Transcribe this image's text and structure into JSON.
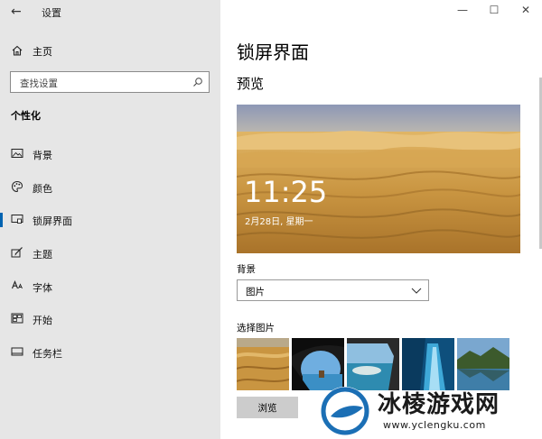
{
  "window": {
    "title": "设置",
    "minimize": "—",
    "maximize": "☐",
    "close": "✕"
  },
  "sidebar": {
    "home_label": "主页",
    "search_placeholder": "查找设置",
    "section_title": "个性化",
    "items": [
      {
        "label": "背景",
        "icon": "picture-icon"
      },
      {
        "label": "颜色",
        "icon": "palette-icon"
      },
      {
        "label": "锁屏界面",
        "icon": "lock-screen-icon",
        "active": true
      },
      {
        "label": "主题",
        "icon": "brush-icon"
      },
      {
        "label": "字体",
        "icon": "font-icon"
      },
      {
        "label": "开始",
        "icon": "start-icon"
      },
      {
        "label": "任务栏",
        "icon": "taskbar-icon"
      }
    ]
  },
  "main": {
    "title": "锁屏界面",
    "preview_heading": "预览",
    "preview": {
      "time": "11:25",
      "date": "2月28日, 星期一"
    },
    "background_label": "背景",
    "background_value": "图片",
    "choose_label": "选择图片",
    "browse_label": "浏览"
  },
  "watermark": {
    "text": "冰棱游戏网",
    "url": "www.yclengku.com"
  },
  "colors": {
    "sidebar_bg": "#e6e6e6",
    "accent": "#0063b1",
    "button_bg": "#cccccc"
  }
}
